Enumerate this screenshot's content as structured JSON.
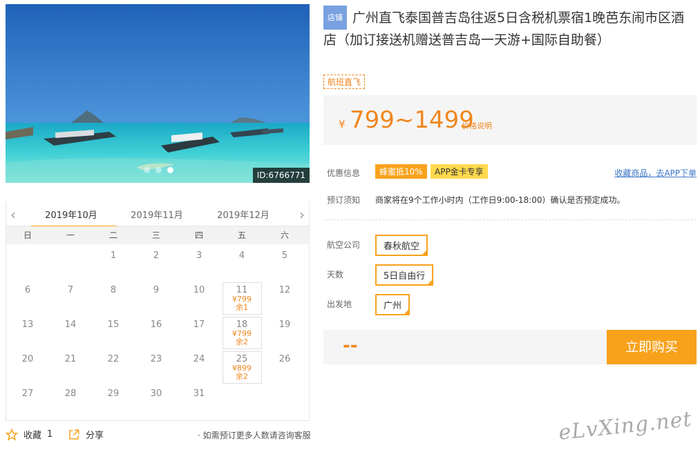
{
  "photo": {
    "id_label": "ID:6766771"
  },
  "calendar": {
    "tabs": [
      "2019年10月",
      "2019年11月",
      "2019年12月"
    ],
    "weekdays": [
      "日",
      "一",
      "二",
      "三",
      "四",
      "五",
      "六"
    ],
    "weeks": [
      [
        {
          "day": ""
        },
        {
          "day": ""
        },
        {
          "day": "1"
        },
        {
          "day": "2"
        },
        {
          "day": "3"
        },
        {
          "day": "4"
        },
        {
          "day": "5"
        }
      ],
      [
        {
          "day": "6"
        },
        {
          "day": "7"
        },
        {
          "day": "8"
        },
        {
          "day": "9"
        },
        {
          "day": "10"
        },
        {
          "day": "11",
          "price": "¥799",
          "remain": "余1"
        },
        {
          "day": "12"
        }
      ],
      [
        {
          "day": "13"
        },
        {
          "day": "14"
        },
        {
          "day": "15"
        },
        {
          "day": "16"
        },
        {
          "day": "17"
        },
        {
          "day": "18",
          "price": "¥799",
          "remain": "余2"
        },
        {
          "day": "19"
        }
      ],
      [
        {
          "day": "20"
        },
        {
          "day": "21"
        },
        {
          "day": "22"
        },
        {
          "day": "23"
        },
        {
          "day": "24"
        },
        {
          "day": "25",
          "price": "¥899",
          "remain": "余2"
        },
        {
          "day": "26"
        }
      ],
      [
        {
          "day": "27"
        },
        {
          "day": "28"
        },
        {
          "day": "29"
        },
        {
          "day": "30"
        },
        {
          "day": "31"
        },
        {
          "day": ""
        },
        {
          "day": ""
        }
      ]
    ]
  },
  "actions": {
    "favorite_label": "收藏",
    "favorite_count": "1",
    "share_label": "分享",
    "consult_text": "· 如需预订更多人数请咨询客服"
  },
  "product": {
    "shop_tag": "店铺",
    "title": "广州直飞泰国普吉岛往返5日含税机票宿1晚芭东闹市区酒店（加订接送机赠送普吉岛一天游+国际自助餐）",
    "flight_tag": "航班直飞",
    "price_symbol": "¥",
    "price_range": "799~1499",
    "price_note": "价格说明"
  },
  "info": {
    "discount_label": "优惠信息",
    "promo_1": "蜂蜜抵10%",
    "promo_2": "APP金卡专享",
    "fav_link": "收藏商品，去APP下单",
    "notice_label": "预订须知",
    "notice_text": "商家将在9个工作小时内（工作日9:00-18:00）确认是否预定成功。"
  },
  "options": {
    "airline_label": "航空公司",
    "airline_value": "春秋航空",
    "days_label": "天数",
    "days_value": "5日自由行",
    "origin_label": "出发地",
    "origin_value": "广州"
  },
  "purchase": {
    "total": "--",
    "buy_label": "立即购买"
  },
  "watermark": "eLvXing.net",
  "colors": {
    "accent": "#f8a21b",
    "price": "#f0861d",
    "link": "#3a76c8",
    "shop_tag": "#79a1e0"
  }
}
